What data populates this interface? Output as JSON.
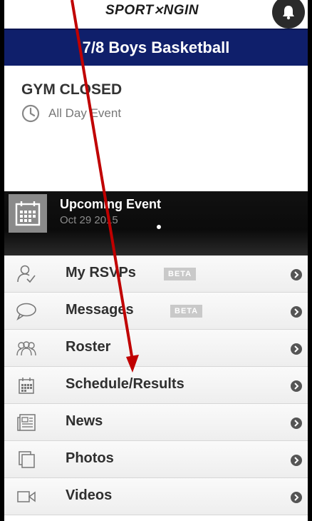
{
  "header": {
    "logo_text": "SPORT",
    "logo_text_2": "NGIN",
    "logo_mark": "✕"
  },
  "team": {
    "name": "7/8 Boys Basketball"
  },
  "event": {
    "title": "GYM CLOSED",
    "time": "All Day Event"
  },
  "upcoming": {
    "label": "Upcoming Event",
    "date": "Oct 29 2015"
  },
  "menu": {
    "items": [
      {
        "label": "My RSVPs",
        "badge": "BETA",
        "icon": "rsvp-icon"
      },
      {
        "label": "Messages",
        "badge": "BETA",
        "icon": "messages-icon"
      },
      {
        "label": "Roster",
        "icon": "roster-icon"
      },
      {
        "label": "Schedule/Results",
        "icon": "calendar-icon"
      },
      {
        "label": "News",
        "icon": "news-icon"
      },
      {
        "label": "Photos",
        "icon": "photos-icon"
      },
      {
        "label": "Videos",
        "icon": "video-icon"
      }
    ]
  },
  "colors": {
    "team_bar": "#0f1f6b",
    "annotation_arrow": "#c00000"
  }
}
